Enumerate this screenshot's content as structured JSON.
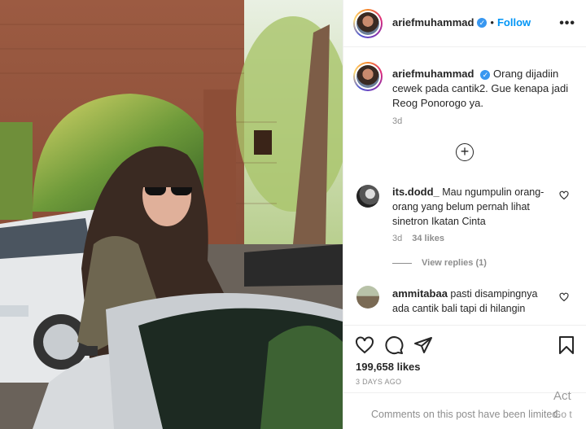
{
  "post": {
    "username": "ariefmuhammad",
    "verified_glyph": "✓",
    "separator": "•",
    "follow_label": "Follow",
    "more_label": "•••",
    "caption": "Orang dijadiin cewek pada cantik2. Gue kenapa jadi Reog Ponorogo ya.",
    "caption_time": "3d",
    "load_more_glyph": "+"
  },
  "comments": [
    {
      "username": "its.dodd_",
      "text": "Mau ngumpulin orang-orang yang belum pernah lihat sinetron Ikatan Cinta",
      "time": "3d",
      "likes": "34 likes",
      "view_replies": "View replies (1)"
    },
    {
      "username": "ammitabaa",
      "text": "pasti disampingnya ada cantik bali tapi di hilangin"
    }
  ],
  "actions": {
    "likes_count": "199,658 likes",
    "date": "3 DAYS AGO",
    "limited_notice": "Comments on this post have been limited."
  },
  "watermark": {
    "line1": "Act",
    "line2": "Go t"
  },
  "icons": [
    "avatar",
    "verified-badge-icon",
    "more-options-icon",
    "add-comment-circle-icon",
    "heart-icon",
    "comment-icon",
    "share-icon",
    "bookmark-icon"
  ],
  "colors": {
    "accent": "#0095f6",
    "verified": "#3897f0",
    "secondary_text": "#8e8e8e",
    "border": "#efefef"
  }
}
